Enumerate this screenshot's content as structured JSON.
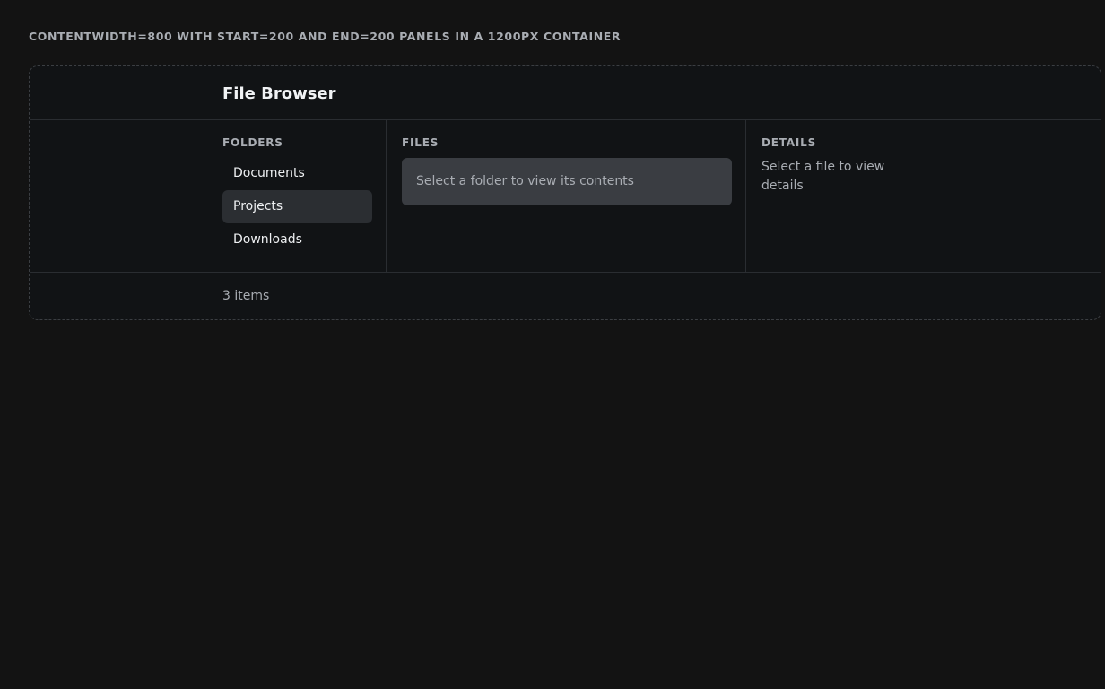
{
  "caption": "CONTENTWIDTH=800 WITH START=200 AND END=200 PANELS IN A 1200PX CONTAINER",
  "header": {
    "title": "File Browser"
  },
  "folders": {
    "label": "FOLDERS",
    "items": [
      {
        "label": "Documents",
        "selected": false
      },
      {
        "label": "Projects",
        "selected": true
      },
      {
        "label": "Downloads",
        "selected": false
      }
    ]
  },
  "files": {
    "label": "FILES",
    "empty_message": "Select a folder to view its contents"
  },
  "details": {
    "label": "DETAILS",
    "empty_message": "Select a file to view details"
  },
  "footer": {
    "item_count": "3 items"
  },
  "colors": {
    "page_background": "#131313",
    "container_background": "#111315",
    "selected_item_background": "#2b2e32",
    "empty_state_background": "#3a3d42",
    "muted_text": "#a9adb3",
    "primary_text": "#f1f3f5"
  }
}
